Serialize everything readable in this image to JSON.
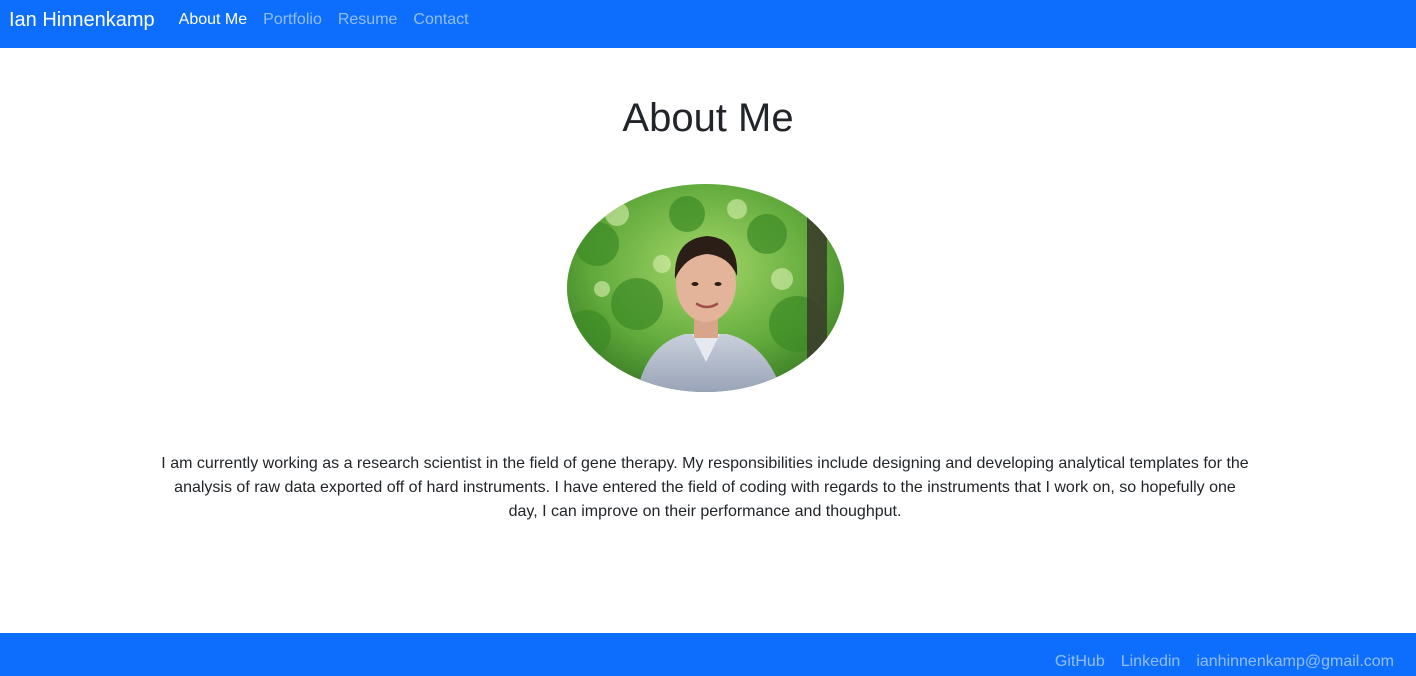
{
  "navbar": {
    "brand": "Ian Hinnenkamp",
    "links": [
      {
        "label": "About Me",
        "active": true
      },
      {
        "label": "Portfolio",
        "active": false
      },
      {
        "label": "Resume",
        "active": false
      },
      {
        "label": "Contact",
        "active": false
      }
    ]
  },
  "main": {
    "title": "About Me",
    "bio": "I am currently working as a research scientist in the field of gene therapy. My responsibilities include designing and developing analytical templates for the analysis of raw data exported off of hard instruments. I have entered the field of coding with regards to the instruments that I work on, so hopefully one day, I can improve on their performance and thoughput."
  },
  "footer": {
    "links": [
      {
        "label": "GitHub"
      },
      {
        "label": "Linkedin"
      },
      {
        "label": "ianhinnenkamp@gmail.com"
      }
    ]
  },
  "colors": {
    "primary": "#0d6efd",
    "text": "#212529",
    "link_muted": "rgba(255,255,255,0.55)",
    "link_active": "#ffffff"
  },
  "icons": {
    "avatar": "profile-photo"
  }
}
